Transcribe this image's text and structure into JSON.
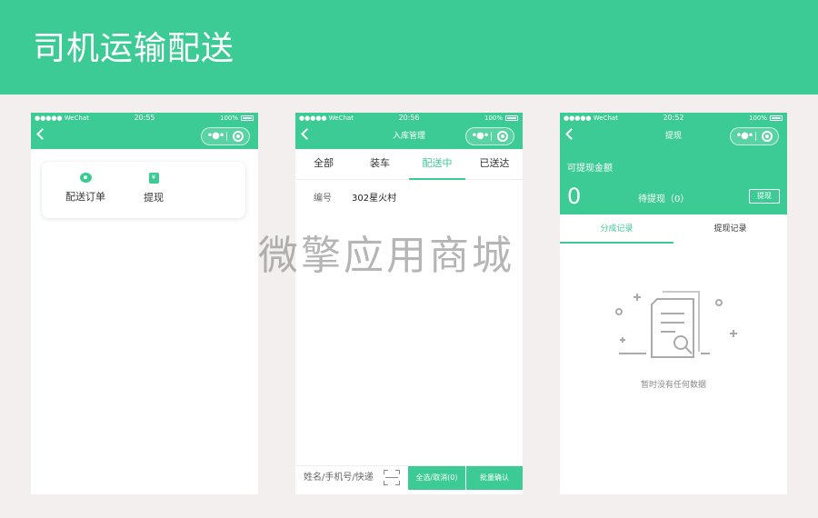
{
  "banner": {
    "title": "司机运输配送"
  },
  "watermark": "微擎应用商城",
  "colors": {
    "accent": "#3ccb94",
    "background": "#f2efee"
  },
  "phones": [
    {
      "status": {
        "carrier": "●●●●● WeChat",
        "time": "20:55",
        "battery": "100%"
      },
      "nav": {
        "title": ""
      },
      "menu": [
        {
          "label": "配送订单",
          "icon": "truck-icon"
        },
        {
          "label": "提现",
          "icon": "yen-icon"
        }
      ]
    },
    {
      "status": {
        "carrier": "●●●●● WeChat",
        "time": "20:56",
        "battery": "100%"
      },
      "nav": {
        "title": "入库管理"
      },
      "tabs": [
        "全部",
        "装车",
        "配送中",
        "已送达"
      ],
      "active_tab": 2,
      "field": {
        "label": "编号",
        "value": "302星火村"
      },
      "search": {
        "placeholder": "姓名/手机号/快递"
      },
      "buttons": {
        "select_all": "全选/取消(0)",
        "batch_confirm": "批量确认"
      }
    },
    {
      "status": {
        "carrier": "●●●●● WeChat",
        "time": "20:52",
        "battery": "100%"
      },
      "nav": {
        "title": "提现"
      },
      "balance": {
        "label": "可提现金额",
        "value": "0",
        "pending": "待提现（0）",
        "withdraw": "提现"
      },
      "tabs": [
        "分成记录",
        "提现记录"
      ],
      "active_tab": 0,
      "empty": "暂时没有任何数据"
    }
  ]
}
